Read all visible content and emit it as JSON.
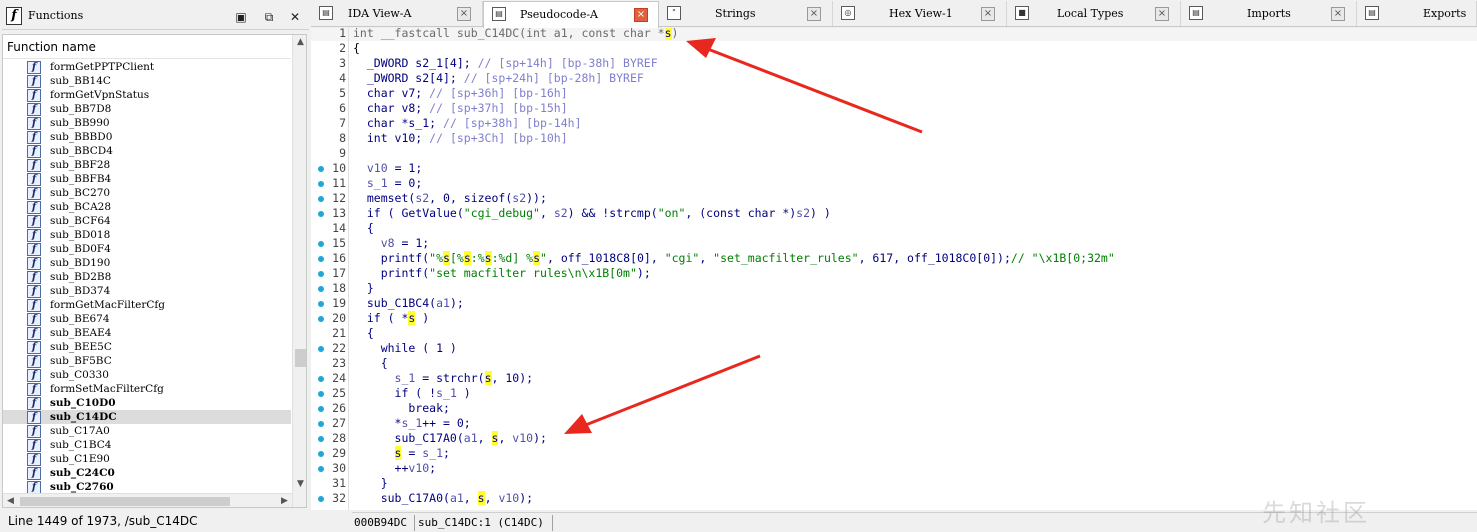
{
  "functions_pane": {
    "title": "Functions",
    "icon_glyph": "f",
    "column_header": "Function name",
    "items": [
      {
        "name": "formGetPPTPClient",
        "bold": false,
        "selected": false
      },
      {
        "name": "sub_BB14C",
        "bold": false,
        "selected": false
      },
      {
        "name": "formGetVpnStatus",
        "bold": false,
        "selected": false
      },
      {
        "name": "sub_BB7D8",
        "bold": false,
        "selected": false
      },
      {
        "name": "sub_BB990",
        "bold": false,
        "selected": false
      },
      {
        "name": "sub_BBBD0",
        "bold": false,
        "selected": false
      },
      {
        "name": "sub_BBCD4",
        "bold": false,
        "selected": false
      },
      {
        "name": "sub_BBF28",
        "bold": false,
        "selected": false
      },
      {
        "name": "sub_BBFB4",
        "bold": false,
        "selected": false
      },
      {
        "name": "sub_BC270",
        "bold": false,
        "selected": false
      },
      {
        "name": "sub_BCA28",
        "bold": false,
        "selected": false
      },
      {
        "name": "sub_BCF64",
        "bold": false,
        "selected": false
      },
      {
        "name": "sub_BD018",
        "bold": false,
        "selected": false
      },
      {
        "name": "sub_BD0F4",
        "bold": false,
        "selected": false
      },
      {
        "name": "sub_BD190",
        "bold": false,
        "selected": false
      },
      {
        "name": "sub_BD2B8",
        "bold": false,
        "selected": false
      },
      {
        "name": "sub_BD374",
        "bold": false,
        "selected": false
      },
      {
        "name": "formGetMacFilterCfg",
        "bold": false,
        "selected": false
      },
      {
        "name": "sub_BE674",
        "bold": false,
        "selected": false
      },
      {
        "name": "sub_BEAE4",
        "bold": false,
        "selected": false
      },
      {
        "name": "sub_BEE5C",
        "bold": false,
        "selected": false
      },
      {
        "name": "sub_BF5BC",
        "bold": false,
        "selected": false
      },
      {
        "name": "sub_C0330",
        "bold": false,
        "selected": false
      },
      {
        "name": "formSetMacFilterCfg",
        "bold": false,
        "selected": false
      },
      {
        "name": "sub_C10D0",
        "bold": true,
        "selected": false
      },
      {
        "name": "sub_C14DC",
        "bold": true,
        "selected": true
      },
      {
        "name": "sub_C17A0",
        "bold": false,
        "selected": false
      },
      {
        "name": "sub_C1BC4",
        "bold": false,
        "selected": false
      },
      {
        "name": "sub_C1E90",
        "bold": false,
        "selected": false
      },
      {
        "name": "sub_C24C0",
        "bold": true,
        "selected": false
      },
      {
        "name": "sub_C2760",
        "bold": true,
        "selected": false
      }
    ],
    "status": "Line 1449 of 1973, /sub_C14DC"
  },
  "tabs": [
    {
      "label": "IDA View-A",
      "icon": "view-icon",
      "active": false
    },
    {
      "label": "Pseudocode-A",
      "icon": "pseudocode-icon",
      "active": true
    },
    {
      "label": "Strings",
      "icon": "strings-icon",
      "active": false
    },
    {
      "label": "Hex View-1",
      "icon": "hex-icon",
      "active": false
    },
    {
      "label": "Local Types",
      "icon": "types-icon",
      "active": false
    },
    {
      "label": "Imports",
      "icon": "imports-icon",
      "active": false
    },
    {
      "label": "Exports",
      "icon": "exports-icon",
      "active": false
    }
  ],
  "code_lines": [
    {
      "n": "1",
      "dot": false,
      "hl": true,
      "parts": [
        [
          "int __fastcall sub_C14DC(int a1, const char *",
          "gray"
        ],
        [
          "s",
          "hi"
        ],
        [
          ")",
          "gray"
        ]
      ]
    },
    {
      "n": "2",
      "dot": false,
      "hl": false,
      "parts": [
        [
          "{",
          "blk"
        ]
      ]
    },
    {
      "n": "3",
      "dot": false,
      "hl": false,
      "parts": [
        [
          "  _DWORD s2_1[4]; ",
          "def"
        ],
        [
          "// [sp+14h] [bp-38h] BYREF",
          "cmt"
        ]
      ]
    },
    {
      "n": "4",
      "dot": false,
      "hl": false,
      "parts": [
        [
          "  _DWORD s2[4]; ",
          "def"
        ],
        [
          "// [sp+24h] [bp-28h] BYREF",
          "cmt"
        ]
      ]
    },
    {
      "n": "5",
      "dot": false,
      "hl": false,
      "parts": [
        [
          "  char v7; ",
          "def"
        ],
        [
          "// [sp+36h] [bp-16h]",
          "cmt"
        ]
      ]
    },
    {
      "n": "6",
      "dot": false,
      "hl": false,
      "parts": [
        [
          "  char v8; ",
          "def"
        ],
        [
          "// [sp+37h] [bp-15h]",
          "cmt"
        ]
      ]
    },
    {
      "n": "7",
      "dot": false,
      "hl": false,
      "parts": [
        [
          "  char *s_1; ",
          "def"
        ],
        [
          "// [sp+38h] [bp-14h]",
          "cmt"
        ]
      ]
    },
    {
      "n": "8",
      "dot": false,
      "hl": false,
      "parts": [
        [
          "  int v10; ",
          "def"
        ],
        [
          "// [sp+3Ch] [bp-10h]",
          "cmt"
        ]
      ]
    },
    {
      "n": "9",
      "dot": false,
      "hl": false,
      "parts": [
        [
          "",
          "def"
        ]
      ]
    },
    {
      "n": "10",
      "dot": true,
      "hl": false,
      "parts": [
        [
          "  ",
          "def"
        ],
        [
          "v10",
          "var"
        ],
        [
          " = 1;",
          "def"
        ]
      ]
    },
    {
      "n": "11",
      "dot": true,
      "hl": false,
      "parts": [
        [
          "  ",
          "def"
        ],
        [
          "s_1",
          "var"
        ],
        [
          " = 0;",
          "def"
        ]
      ]
    },
    {
      "n": "12",
      "dot": true,
      "hl": false,
      "parts": [
        [
          "  memset(",
          "def"
        ],
        [
          "s2",
          "var"
        ],
        [
          ", 0, sizeof(",
          "def"
        ],
        [
          "s2",
          "var"
        ],
        [
          "));",
          "def"
        ]
      ]
    },
    {
      "n": "13",
      "dot": true,
      "hl": false,
      "parts": [
        [
          "  if ( GetValue(",
          "def"
        ],
        [
          "\"cgi_debug\"",
          "str"
        ],
        [
          ", ",
          "def"
        ],
        [
          "s2",
          "var"
        ],
        [
          ") && !strcmp(",
          "def"
        ],
        [
          "\"on\"",
          "str"
        ],
        [
          ", (const char *)",
          "def"
        ],
        [
          "s2",
          "var"
        ],
        [
          ") )",
          "def"
        ]
      ]
    },
    {
      "n": "14",
      "dot": false,
      "hl": false,
      "parts": [
        [
          "  {",
          "def"
        ]
      ]
    },
    {
      "n": "15",
      "dot": true,
      "hl": false,
      "parts": [
        [
          "    ",
          "def"
        ],
        [
          "v8",
          "var"
        ],
        [
          " = 1;",
          "def"
        ]
      ]
    },
    {
      "n": "16",
      "dot": true,
      "hl": false,
      "parts": [
        [
          "    printf(",
          "def"
        ],
        [
          "\"%",
          "str"
        ],
        [
          "s",
          "hi"
        ],
        [
          "[%",
          "str"
        ],
        [
          "s",
          "hi"
        ],
        [
          ":%",
          "str"
        ],
        [
          "s",
          "hi"
        ],
        [
          ":%d] %",
          "str"
        ],
        [
          "s",
          "hi"
        ],
        [
          "\"",
          "str"
        ],
        [
          ", off_1018C8[0], ",
          "def"
        ],
        [
          "\"cgi\"",
          "str"
        ],
        [
          ", ",
          "def"
        ],
        [
          "\"set_macfilter_rules\"",
          "str"
        ],
        [
          ", 617, off_1018C0[0]);",
          "def"
        ],
        [
          "// \"\\x1B[0;32m\"",
          "str"
        ]
      ]
    },
    {
      "n": "17",
      "dot": true,
      "hl": false,
      "parts": [
        [
          "    printf(",
          "def"
        ],
        [
          "\"set macfilter rules\\n\\x1B[0m\"",
          "str"
        ],
        [
          ");",
          "def"
        ]
      ]
    },
    {
      "n": "18",
      "dot": true,
      "hl": false,
      "parts": [
        [
          "  }",
          "def"
        ]
      ]
    },
    {
      "n": "19",
      "dot": true,
      "hl": false,
      "parts": [
        [
          "  sub_C1BC4(",
          "def"
        ],
        [
          "a1",
          "var"
        ],
        [
          ");",
          "def"
        ]
      ]
    },
    {
      "n": "20",
      "dot": true,
      "hl": false,
      "parts": [
        [
          "  if ( *",
          "def"
        ],
        [
          "s",
          "hi"
        ],
        [
          " )",
          "def"
        ]
      ]
    },
    {
      "n": "21",
      "dot": false,
      "hl": false,
      "parts": [
        [
          "  {",
          "def"
        ]
      ]
    },
    {
      "n": "22",
      "dot": true,
      "hl": false,
      "parts": [
        [
          "    while ( 1 )",
          "def"
        ]
      ]
    },
    {
      "n": "23",
      "dot": false,
      "hl": false,
      "parts": [
        [
          "    {",
          "def"
        ]
      ]
    },
    {
      "n": "24",
      "dot": true,
      "hl": false,
      "parts": [
        [
          "      ",
          "def"
        ],
        [
          "s_1",
          "var"
        ],
        [
          " = strchr(",
          "def"
        ],
        [
          "s",
          "hi"
        ],
        [
          ", 10);",
          "def"
        ]
      ]
    },
    {
      "n": "25",
      "dot": true,
      "hl": false,
      "parts": [
        [
          "      if ( !",
          "def"
        ],
        [
          "s_1",
          "var"
        ],
        [
          " )",
          "def"
        ]
      ]
    },
    {
      "n": "26",
      "dot": true,
      "hl": false,
      "parts": [
        [
          "        break;",
          "def"
        ]
      ]
    },
    {
      "n": "27",
      "dot": true,
      "hl": false,
      "parts": [
        [
          "      *",
          "def"
        ],
        [
          "s_1",
          "var"
        ],
        [
          "++ = 0;",
          "def"
        ]
      ]
    },
    {
      "n": "28",
      "dot": true,
      "hl": false,
      "parts": [
        [
          "      sub_C17A0(",
          "def"
        ],
        [
          "a1",
          "var"
        ],
        [
          ", ",
          "def"
        ],
        [
          "s",
          "hi"
        ],
        [
          ", ",
          "def"
        ],
        [
          "v10",
          "var"
        ],
        [
          ");",
          "def"
        ]
      ]
    },
    {
      "n": "29",
      "dot": true,
      "hl": false,
      "parts": [
        [
          "      ",
          "def"
        ],
        [
          "s",
          "hi"
        ],
        [
          " = ",
          "def"
        ],
        [
          "s_1",
          "var"
        ],
        [
          ";",
          "def"
        ]
      ]
    },
    {
      "n": "30",
      "dot": true,
      "hl": false,
      "parts": [
        [
          "      ++",
          "def"
        ],
        [
          "v10",
          "var"
        ],
        [
          ";",
          "def"
        ]
      ]
    },
    {
      "n": "31",
      "dot": false,
      "hl": false,
      "parts": [
        [
          "    }",
          "def"
        ]
      ]
    },
    {
      "n": "32",
      "dot": true,
      "hl": false,
      "parts": [
        [
          "    sub_C17A0(",
          "def"
        ],
        [
          "a1",
          "var"
        ],
        [
          ", ",
          "def"
        ],
        [
          "s",
          "hi"
        ],
        [
          ", ",
          "def"
        ],
        [
          "v10",
          "var"
        ],
        [
          ");",
          "def"
        ]
      ]
    }
  ],
  "status_bar": {
    "address": "000B94DC",
    "location": "sub_C14DC:1 (C14DC)"
  },
  "watermark": "先知社区",
  "colors": {
    "keyword": "#00007f",
    "comment": "#7f7fcf",
    "string": "#007f00",
    "highlight": "#ffff30",
    "annotation_arrow": "#e8281e",
    "breakpoint_dot": "#22a5d8"
  }
}
